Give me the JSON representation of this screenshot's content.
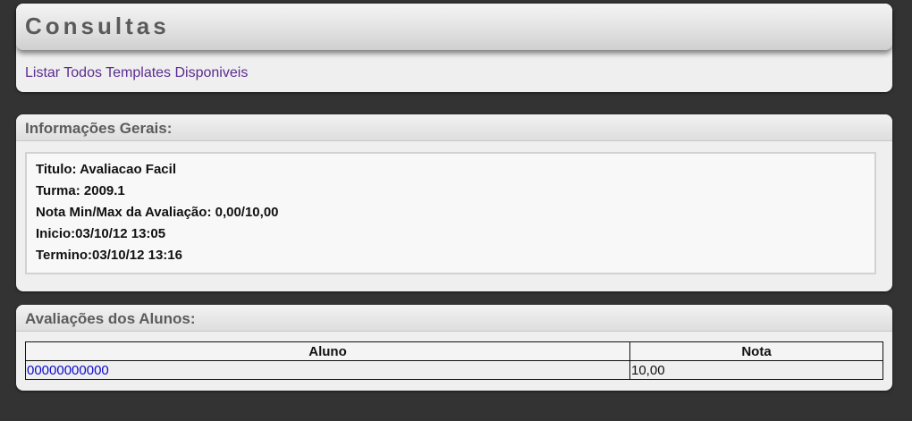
{
  "consultas": {
    "title": "Consultas",
    "link_listar_templates": "Listar Todos Templates Disponiveis"
  },
  "informacoes_gerais": {
    "title": "Informações Gerais:",
    "lines": [
      "Titulo: Avaliacao Facil",
      "Turma: 2009.1",
      "Nota Min/Max da Avaliação: 0,00/10,00",
      "Inicio:03/10/12 13:05",
      "Termino:03/10/12 13:16"
    ]
  },
  "avaliacoes_alunos": {
    "title": "Avaliações dos Alunos:",
    "columns": [
      "Aluno",
      "Nota"
    ],
    "rows": [
      {
        "aluno": "00000000000",
        "nota": "10,00"
      }
    ]
  },
  "colors": {
    "background": "#333333",
    "panel": "#efefef",
    "link_purple": "#5b2d91",
    "link_blue": "#0a0acc"
  }
}
